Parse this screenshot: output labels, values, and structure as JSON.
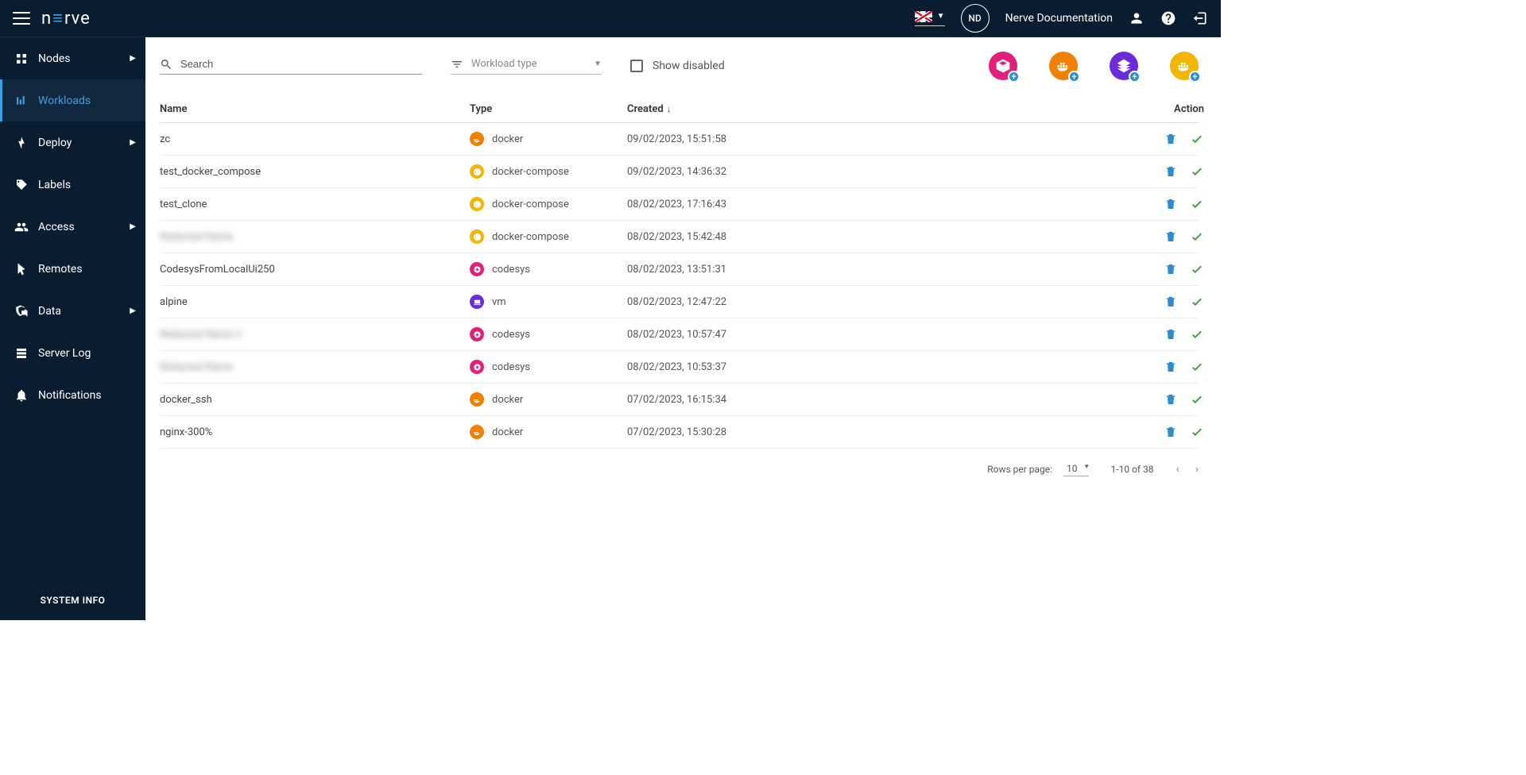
{
  "header": {
    "avatar_initials": "ND",
    "username": "Nerve Documentation"
  },
  "sidebar": {
    "items": [
      {
        "label": "Nodes",
        "has_arrow": true
      },
      {
        "label": "Workloads",
        "has_arrow": false,
        "active": true
      },
      {
        "label": "Deploy",
        "has_arrow": true
      },
      {
        "label": "Labels",
        "has_arrow": false
      },
      {
        "label": "Access",
        "has_arrow": true
      },
      {
        "label": "Remotes",
        "has_arrow": false
      },
      {
        "label": "Data",
        "has_arrow": true
      },
      {
        "label": "Server Log",
        "has_arrow": false
      },
      {
        "label": "Notifications",
        "has_arrow": false
      }
    ],
    "system_info": "SYSTEM INFO"
  },
  "toolbar": {
    "search_placeholder": "Search",
    "filter_placeholder": "Workload type",
    "show_disabled_label": "Show disabled"
  },
  "add_buttons": [
    {
      "name": "add-codesys",
      "color": "#e0217c"
    },
    {
      "name": "add-docker",
      "color": "#f08000"
    },
    {
      "name": "add-vm",
      "color": "#6a2bd8"
    },
    {
      "name": "add-docker-compose",
      "color": "#f2b500"
    }
  ],
  "columns": {
    "name": "Name",
    "type": "Type",
    "created": "Created",
    "action": "Action"
  },
  "type_colors": {
    "docker": "#f08000",
    "docker-compose": "#f2b500",
    "codesys": "#e0217c",
    "vm": "#6a2bd8"
  },
  "rows": [
    {
      "name": "zc",
      "type": "docker",
      "created": "09/02/2023, 15:51:58"
    },
    {
      "name": "test_docker_compose",
      "type": "docker-compose",
      "created": "09/02/2023, 14:36:32"
    },
    {
      "name": "test_clone",
      "type": "docker-compose",
      "created": "08/02/2023, 17:16:43"
    },
    {
      "name": "Redacted Name",
      "type": "docker-compose",
      "created": "08/02/2023, 15:42:48",
      "blurred": true
    },
    {
      "name": "CodesysFromLocalUi250",
      "type": "codesys",
      "created": "08/02/2023, 13:51:31"
    },
    {
      "name": "alpine",
      "type": "vm",
      "created": "08/02/2023, 12:47:22"
    },
    {
      "name": "Redacted Name 2",
      "type": "codesys",
      "created": "08/02/2023, 10:57:47",
      "blurred": true
    },
    {
      "name": "Redacted Name",
      "type": "codesys",
      "created": "08/02/2023, 10:53:37",
      "blurred": true
    },
    {
      "name": "docker_ssh",
      "type": "docker",
      "created": "07/02/2023, 16:15:34"
    },
    {
      "name": "nginx-300%",
      "type": "docker",
      "created": "07/02/2023, 15:30:28"
    }
  ],
  "pager": {
    "rows_per_page_label": "Rows per page:",
    "rows_per_page_value": "10",
    "range": "1-10 of 38"
  }
}
